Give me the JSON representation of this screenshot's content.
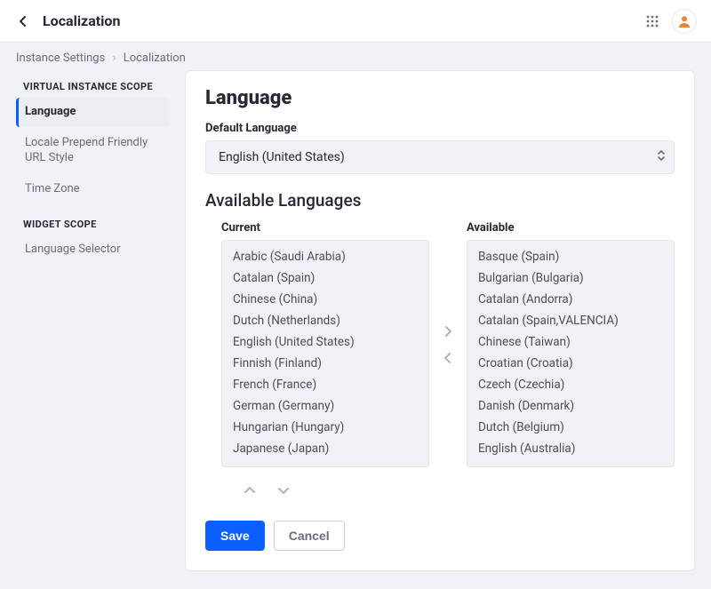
{
  "topbar": {
    "title": "Localization"
  },
  "breadcrumb": {
    "parent": "Instance Settings",
    "current": "Localization"
  },
  "sidebar": {
    "scope1": "VIRTUAL INSTANCE SCOPE",
    "items1": [
      {
        "label": "Language"
      },
      {
        "label": "Locale Prepend Friendly URL Style"
      },
      {
        "label": "Time Zone"
      }
    ],
    "scope2": "WIDGET SCOPE",
    "items2": [
      {
        "label": "Language Selector"
      }
    ]
  },
  "panel": {
    "heading": "Language",
    "default_label": "Default Language",
    "default_value": "English (United States)",
    "available_heading": "Available Languages",
    "current_title": "Current",
    "available_title": "Available",
    "current": [
      "Arabic (Saudi Arabia)",
      "Catalan (Spain)",
      "Chinese (China)",
      "Dutch (Netherlands)",
      "English (United States)",
      "Finnish (Finland)",
      "French (France)",
      "German (Germany)",
      "Hungarian (Hungary)",
      "Japanese (Japan)"
    ],
    "available": [
      "Basque (Spain)",
      "Bulgarian (Bulgaria)",
      "Catalan (Andorra)",
      "Catalan (Spain,VALENCIA)",
      "Chinese (Taiwan)",
      "Croatian (Croatia)",
      "Czech (Czechia)",
      "Danish (Denmark)",
      "Dutch (Belgium)",
      "English (Australia)"
    ],
    "save_label": "Save",
    "cancel_label": "Cancel"
  }
}
